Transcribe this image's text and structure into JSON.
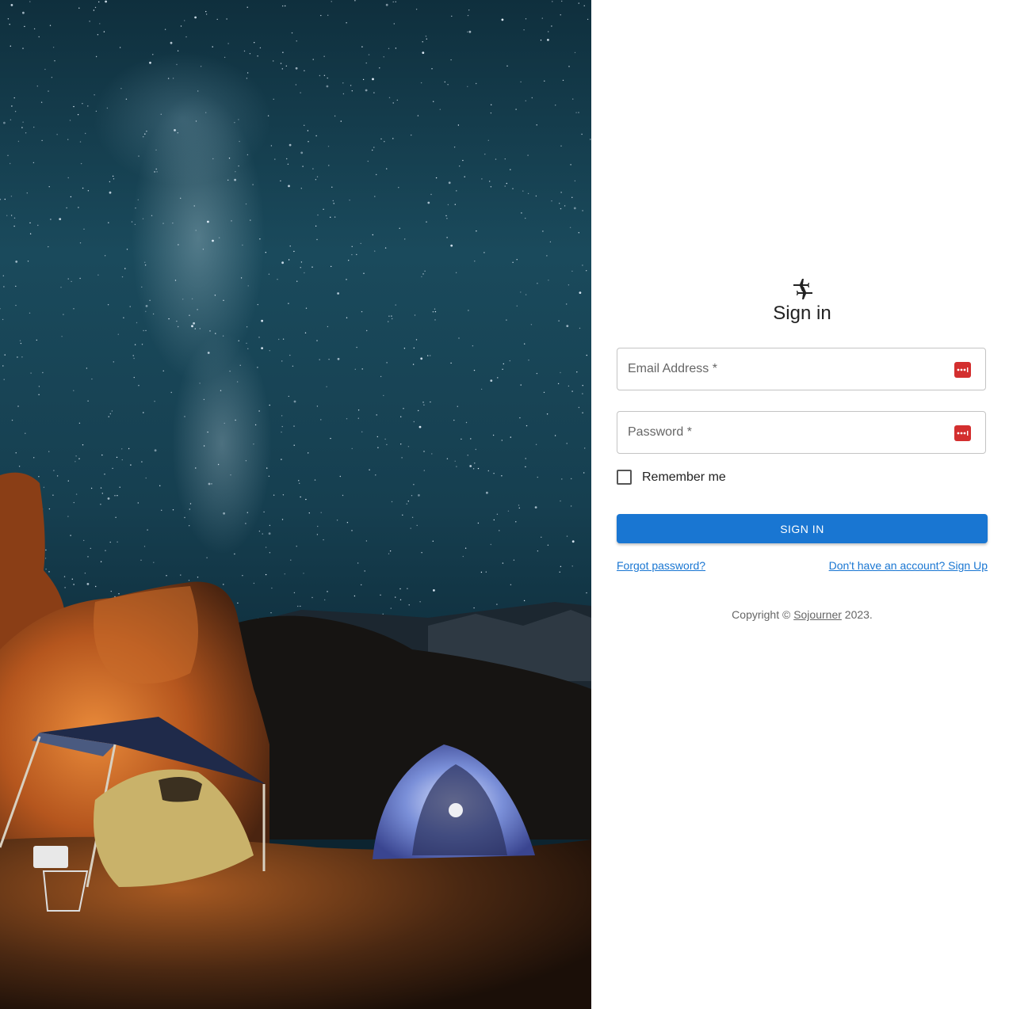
{
  "logo": {
    "icon": "connecting-airports-icon"
  },
  "title": "Sign in",
  "email": {
    "label": "Email Address",
    "required_mark": "*",
    "value": ""
  },
  "password": {
    "label": "Password",
    "required_mark": "*",
    "value": ""
  },
  "remember": {
    "label": "Remember me",
    "checked": false
  },
  "signin_button": {
    "label": "SIGN IN"
  },
  "links": {
    "forgot": "Forgot password?",
    "signup": "Don't have an account? Sign Up"
  },
  "copyright": {
    "prefix": "Copyright ©",
    "brand": "Sojourner",
    "suffix": "2023."
  },
  "colors": {
    "primary": "#1976d2",
    "password_manager_badge": "#d32f2f"
  }
}
